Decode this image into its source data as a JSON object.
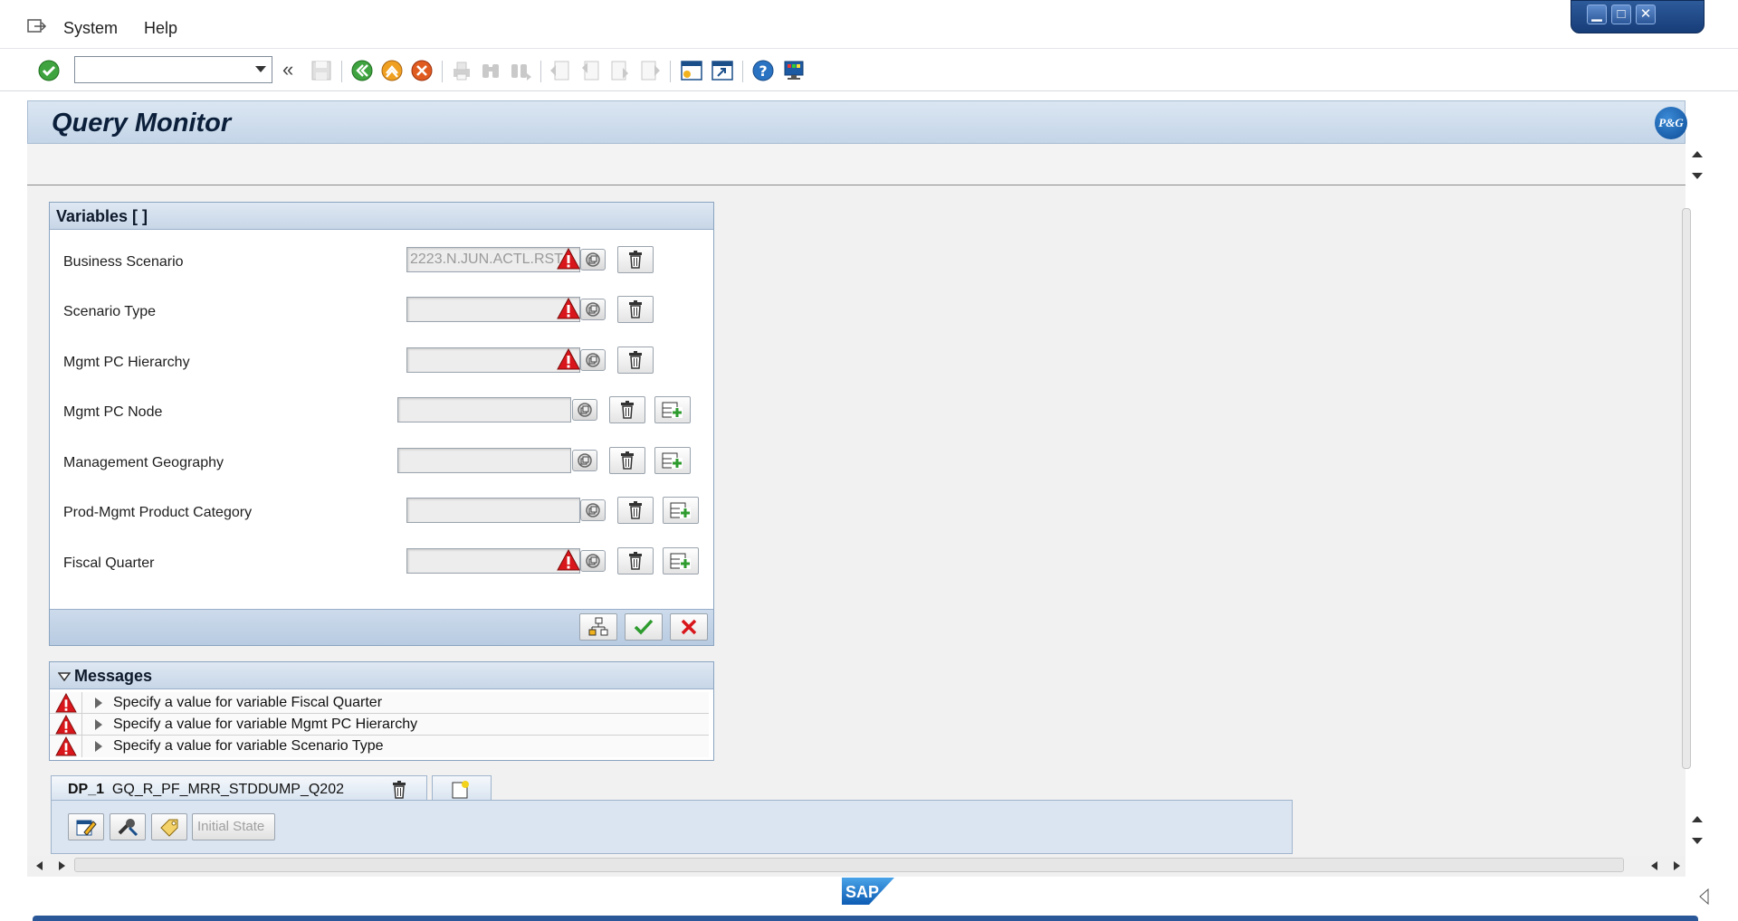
{
  "menu": {
    "items": [
      "System",
      "Help"
    ]
  },
  "toolbar": {
    "command_field_value": "",
    "icons": [
      "enter-icon",
      "command-field",
      "collapse-icon",
      "save-icon",
      "back-icon",
      "exit-icon",
      "cancel-icon",
      "print-icon",
      "find-icon",
      "find-next-icon",
      "first-page-icon",
      "previous-page-icon",
      "next-page-icon",
      "last-page-icon",
      "create-session-icon",
      "shortcut-icon",
      "help-icon",
      "customize-layout-icon"
    ]
  },
  "header": {
    "title": "Query Monitor",
    "logo_text": "P&G"
  },
  "variables": {
    "title": "Variables [ ]",
    "rows": [
      {
        "label": "Business Scenario",
        "value": "2223.N.JUN.ACTL.RST",
        "required": true,
        "multi": false
      },
      {
        "label": "Scenario Type",
        "value": "",
        "required": true,
        "multi": false
      },
      {
        "label": "Mgmt PC Hierarchy",
        "value": "",
        "required": true,
        "multi": false
      },
      {
        "label": "Mgmt PC Node",
        "value": "",
        "required": false,
        "multi": true
      },
      {
        "label": "Management Geography",
        "value": "",
        "required": false,
        "multi": true
      },
      {
        "label": "Prod-Mgmt Product Category",
        "value": "",
        "required": false,
        "multi": true
      },
      {
        "label": "Fiscal Quarter",
        "value": "",
        "required": true,
        "multi": true
      }
    ]
  },
  "messages": {
    "title": "Messages",
    "items": [
      "Specify a value for variable Fiscal Quarter",
      "Specify a value for variable Mgmt PC Hierarchy",
      "Specify a value for variable Scenario Type"
    ]
  },
  "tabs": {
    "active_prefix": "DP_1",
    "active_name": "GQ_R_PF_MRR_STDDUMP_Q202"
  },
  "dataprovider": {
    "initial_state_label": "Initial State"
  },
  "colors": {
    "header_blue": "#c4d5e8",
    "warning_red": "#d8161b",
    "ok_green": "#2e9b2e",
    "sap_blue": "#1f6fc4"
  }
}
